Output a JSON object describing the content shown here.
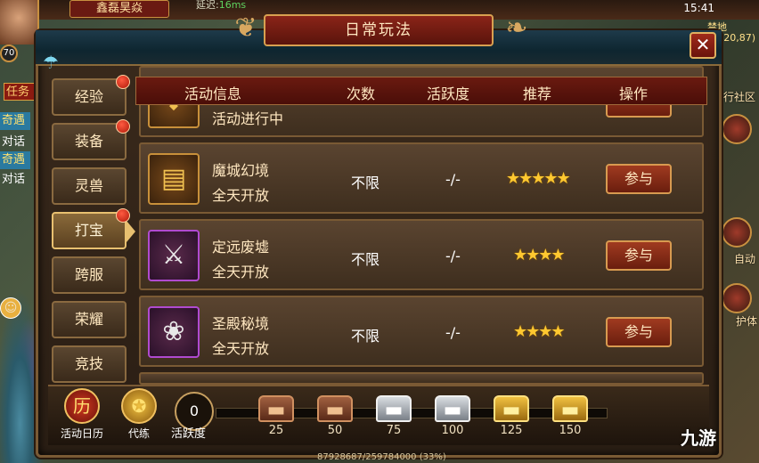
{
  "hud": {
    "player_name": "鑫磊昊焱",
    "latency_label": "延迟:",
    "latency_value": "16ms",
    "clock": "15:41",
    "map_name": "禁地",
    "coords": "(20,87)",
    "level": "70",
    "left_tags": [
      "任务",
      "奇遇",
      "对话",
      "奇遇",
      "对话"
    ],
    "right_labels": [
      "行社区",
      "自动",
      "护体"
    ]
  },
  "panel": {
    "title": "日常玩法",
    "close_label": "✕"
  },
  "tabs": [
    {
      "label": "经验",
      "badge": true,
      "active": false
    },
    {
      "label": "装备",
      "badge": true,
      "active": false
    },
    {
      "label": "灵兽",
      "badge": false,
      "active": false
    },
    {
      "label": "打宝",
      "badge": true,
      "active": true
    },
    {
      "label": "跨服",
      "badge": false,
      "active": false
    },
    {
      "label": "荣耀",
      "badge": false,
      "active": false
    },
    {
      "label": "竞技",
      "badge": false,
      "active": false
    }
  ],
  "table": {
    "headers": {
      "info": "活动信息",
      "count": "次数",
      "activity": "活跃度",
      "recommend": "推荐",
      "action": "操作"
    },
    "partial_row": {
      "status": "活动进行中"
    },
    "rows": [
      {
        "name": "魔城幻境",
        "time": "全天开放",
        "count": "不限",
        "activity": "-/-",
        "stars": "★★★★★",
        "rating": 5,
        "button": "参与",
        "icon": "chest-icon"
      },
      {
        "name": "定远废墟",
        "time": "全天开放",
        "count": "不限",
        "activity": "-/-",
        "stars": "★★★★",
        "rating": 4,
        "button": "参与",
        "icon": "sword-icon"
      },
      {
        "name": "圣殿秘境",
        "time": "全天开放",
        "count": "不限",
        "activity": "-/-",
        "stars": "★★★★",
        "rating": 4,
        "button": "参与",
        "icon": "wings-icon"
      }
    ]
  },
  "bottom": {
    "calendar_label": "活动日历",
    "calendar_glyph": "历",
    "practice_label": "代练",
    "activity_value": "0",
    "activity_label": "活跃度",
    "chests": [
      {
        "value": "25",
        "tier": "bronze"
      },
      {
        "value": "50",
        "tier": "bronze"
      },
      {
        "value": "75",
        "tier": "silver"
      },
      {
        "value": "100",
        "tier": "silver"
      },
      {
        "value": "125",
        "tier": "gold"
      },
      {
        "value": "150",
        "tier": "gold"
      }
    ],
    "exp_text": "87928687/259784000 (33%)"
  },
  "watermark": "九游"
}
